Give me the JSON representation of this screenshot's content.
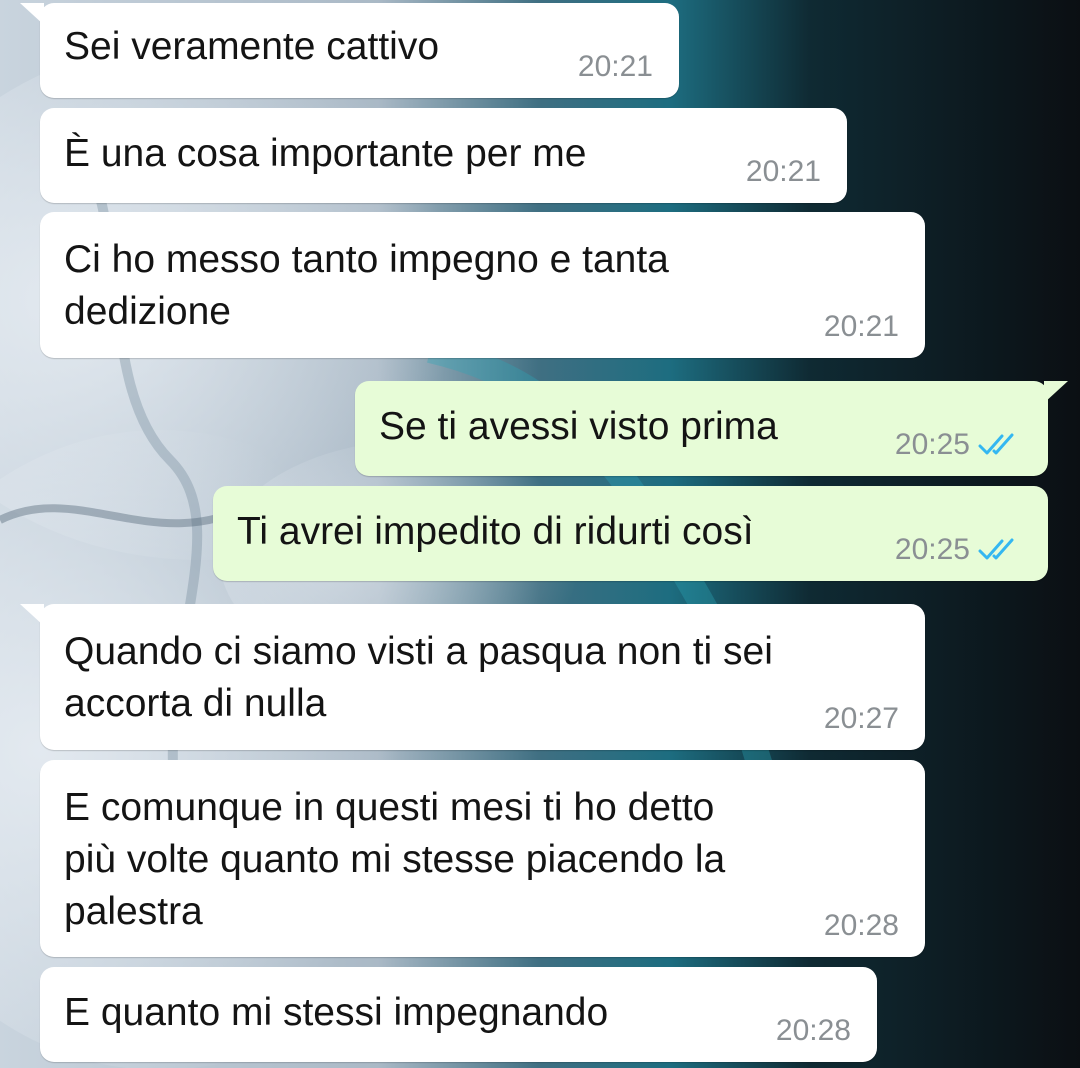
{
  "chat": {
    "messages": [
      {
        "direction": "incoming",
        "text": "Sei veramente cattivo",
        "time": "20:21"
      },
      {
        "direction": "incoming",
        "text": "È una cosa importante per me",
        "time": "20:21"
      },
      {
        "direction": "incoming",
        "text": "Ci ho messo tanto impegno e tanta\ndedizione",
        "time": "20:21"
      },
      {
        "direction": "outgoing",
        "text": "Se ti avessi visto prima",
        "time": "20:25",
        "status": "read"
      },
      {
        "direction": "outgoing",
        "text": "Ti avrei impedito di ridurti così",
        "time": "20:25",
        "status": "read"
      },
      {
        "direction": "incoming",
        "text": "Quando ci siamo visti a pasqua non ti sei\naccorta di nulla",
        "time": "20:27"
      },
      {
        "direction": "incoming",
        "text": "E comunque in questi mesi ti ho detto\npiù volte quanto mi stesse piacendo la\npalestra",
        "time": "20:28"
      },
      {
        "direction": "incoming",
        "text": "E quanto mi stessi impegnando",
        "time": "20:28"
      }
    ]
  },
  "colors": {
    "incoming_bubble": "#ffffff",
    "outgoing_bubble": "#e7fcd7",
    "read_ticks": "#34b7f1",
    "time_text": "#8a8f93"
  },
  "icons": {
    "read_receipt": "double-check-icon"
  }
}
